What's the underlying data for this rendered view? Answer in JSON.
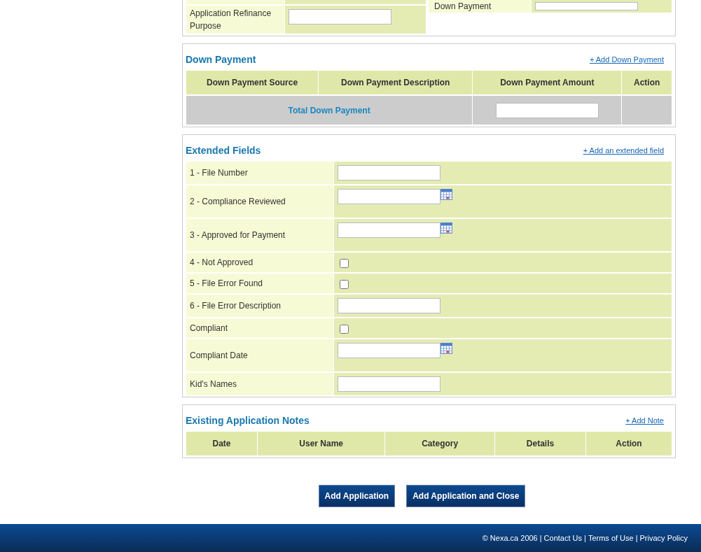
{
  "top_section": {
    "left_rows": [
      {
        "label": "Application Refinance Purpose"
      }
    ],
    "right_rows": [
      {
        "label": "Down Payment"
      }
    ]
  },
  "down_payment": {
    "title": "Down Payment",
    "add_link": "+ Add Down Payment",
    "columns": [
      "Down Payment Source",
      "Down Payment Description",
      "Down Payment Amount",
      "Action"
    ],
    "total_label": "Total Down Payment"
  },
  "extended_fields": {
    "title": "Extended Fields",
    "add_link": "+ Add an extended field",
    "fields": [
      {
        "label": "1 - File Number",
        "kind": "text"
      },
      {
        "label": "2 - Compliance Reviewed",
        "kind": "date"
      },
      {
        "label": "3 - Approved for Payment",
        "kind": "date"
      },
      {
        "label": "4 - Not Approved",
        "kind": "checkbox",
        "checked": false
      },
      {
        "label": "5 - File Error Found",
        "kind": "checkbox",
        "checked": false
      },
      {
        "label": "6 - File Error Description",
        "kind": "text"
      },
      {
        "label": "Compliant",
        "kind": "checkbox",
        "checked": false
      },
      {
        "label": "Compliant Date",
        "kind": "date"
      },
      {
        "label": "Kid's Names",
        "kind": "text"
      }
    ]
  },
  "notes": {
    "title": "Existing Application Notes",
    "add_link": "+ Add Note",
    "columns": [
      "Date",
      "User Name",
      "Category",
      "Details",
      "Action"
    ]
  },
  "buttons": [
    "Add Application",
    "Add Application and Close"
  ],
  "footer": {
    "copyright": "© Nexa.ca 2006",
    "links": [
      "Contact Us",
      "Terms of Use",
      "Privacy Policy"
    ],
    "separators": [
      "|",
      "|",
      "|"
    ]
  }
}
